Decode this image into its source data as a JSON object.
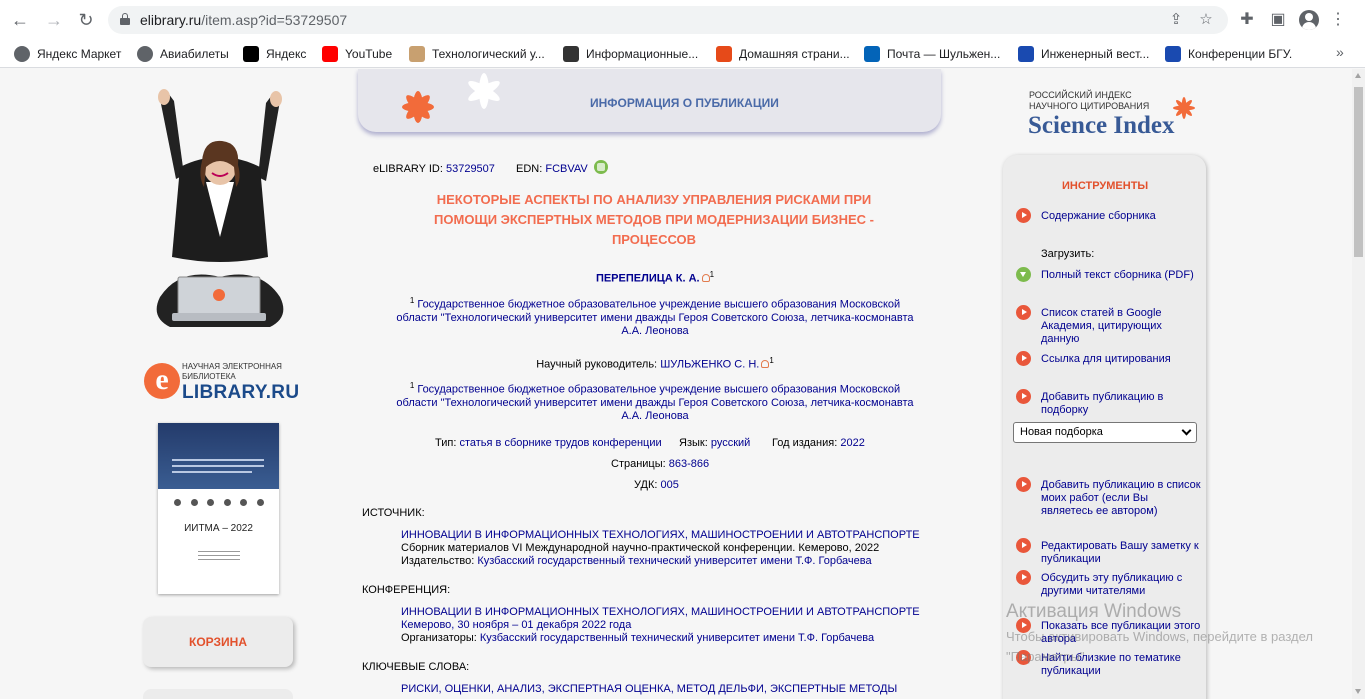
{
  "browser": {
    "url_host": "elibrary.ru",
    "url_path": "/item.asp?id=53729507",
    "bookmarks": [
      {
        "label": "Яндекс Маркет",
        "icon": "globe-icon",
        "color": "#5f6368"
      },
      {
        "label": "Авиабилеты",
        "icon": "globe-icon",
        "color": "#5f6368"
      },
      {
        "label": "Яндекс",
        "icon": "yandex-icon",
        "color": "#000000"
      },
      {
        "label": "YouTube",
        "icon": "youtube-icon",
        "color": "#ff0000"
      },
      {
        "label": "Технологический у...",
        "icon": "university-icon",
        "color": "#c8a070"
      },
      {
        "label": "Информационные...",
        "icon": "ppt-icon",
        "color": "#333333"
      },
      {
        "label": "Домашняя страни...",
        "icon": "office-icon",
        "color": "#e64a19"
      },
      {
        "label": "Почта — Шульжен...",
        "icon": "outlook-icon",
        "color": "#0364b8"
      },
      {
        "label": "Инженерный вест...",
        "icon": "journal-icon",
        "color": "#1a4ab0"
      },
      {
        "label": "Конференции БГУ.",
        "icon": "bgu-icon",
        "color": "#1a4ab0"
      }
    ]
  },
  "left": {
    "elib_small": "НАУЧНАЯ ЭЛЕКТРОННАЯ БИБЛИОТЕКА",
    "elib_big": "LIBRARY.RU",
    "elib_e": "e",
    "cover_title": "ИИТМА – 2022",
    "cart": "КОРЗИНА"
  },
  "header": {
    "title": "ИНФОРМАЦИЯ О ПУБЛИКАЦИИ"
  },
  "publication": {
    "id_label": "eLIBRARY ID:",
    "id": "53729507",
    "edn_label": "EDN:",
    "edn": "FCBVAV",
    "title_lines": [
      "НЕКОТОРЫЕ АСПЕКТЫ ПО АНАЛИЗУ УПРАВЛЕНИЯ РИСКАМИ ПРИ",
      "ПОМОЩИ ЭКСПЕРТНЫХ МЕТОДОВ ПРИ МОДЕРНИЗАЦИИ БИЗНЕС -",
      "ПРОЦЕССОВ"
    ],
    "author": "ПЕРЕПЕЛИЦА К. А.",
    "author_sup": "1",
    "affiliation_sup": "1",
    "affiliation_lines": [
      "Государственное бюджетное образовательное учреждение высшего образования Московской",
      "области \"Технологический университет имени дважды Героя Советского Союза, летчика-космонавта",
      "А.А. Леонова"
    ],
    "supervisor_label": "Научный руководитель:",
    "supervisor": "ШУЛЬЖЕНКО С. Н.",
    "supervisor_sup": "1",
    "type_label": "Тип:",
    "type": "статья в сборнике трудов конференции",
    "lang_label": "Язык:",
    "lang": "русский",
    "year_label": "Год издания:",
    "year": "2022",
    "pages_label": "Страницы:",
    "pages": "863-866",
    "udk_label": "УДК:",
    "udk": "005"
  },
  "source": {
    "label": "ИСТОЧНИК:",
    "title": "ИННОВАЦИИ В ИНФОРМАЦИОННЫХ ТЕХНОЛОГИЯХ, МАШИНОСТРОЕНИИ И АВТОТРАНСПОРТЕ",
    "desc": "Сборник материалов VI Международной научно-практической конференции. Кемерово, 2022",
    "publisher_label": "Издательство:",
    "publisher": "Кузбасский государственный технический университет имени Т.Ф. Горбачева"
  },
  "conference": {
    "label": "КОНФЕРЕНЦИЯ:",
    "title": "ИННОВАЦИИ В ИНФОРМАЦИОННЫХ ТЕХНОЛОГИЯХ, МАШИНОСТРОЕНИИ И АВТОТРАНСПОРТЕ",
    "place": "Кемерово, 30 ноября – 01 декабря 2022 года",
    "org_label": "Организаторы:",
    "org": "Кузбасский государственный технический университет имени Т.Ф. Горбачева"
  },
  "keywords": {
    "label": "КЛЮЧЕВЫЕ СЛОВА:",
    "list": "РИСКИ, ОЦЕНКИ, АНАЛИЗ, ЭКСПЕРТНАЯ ОЦЕНКА, МЕТОД ДЕЛЬФИ, ЭКСПЕРТНЫЕ МЕТОДЫ"
  },
  "right": {
    "si_small_1": "РОССИЙСКИЙ ИНДЕКС",
    "si_small_2": "НАУЧНОГО ЦИТИРОВАНИЯ",
    "si_big": "Science Index",
    "tools_title": "ИНСТРУМЕНТЫ",
    "download_label": "Загрузить:",
    "select_value": "Новая подборка",
    "items": [
      "Содержание сборника",
      "Полный текст сборника (PDF)",
      "Список статей в Google Академия, цитирующих данную",
      "Ссылка для цитирования",
      "Добавить публикацию в подборку",
      "Добавить публикацию в список моих работ (если Вы являетесь ее автором)",
      "Редактировать Вашу заметку к публикации",
      "Обсудить эту публикацию с другими читателями",
      "Показать все публикации этого автора",
      "Найти близкие по тематике публикации"
    ]
  },
  "watermark": {
    "line1": "Активация Windows",
    "line2": "Чтобы активировать Windows, перейдите в раздел \"Параметры\"."
  }
}
